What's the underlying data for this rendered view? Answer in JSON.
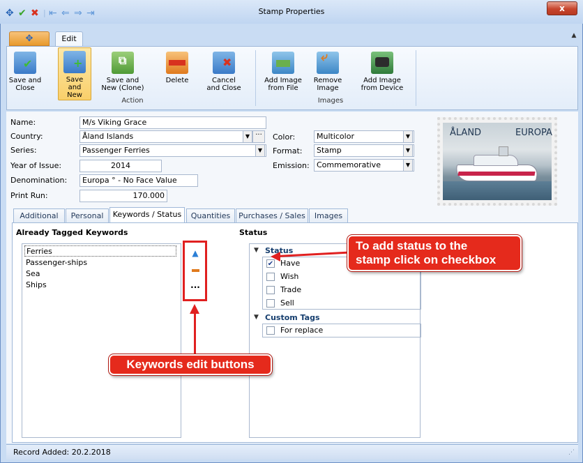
{
  "window": {
    "title": "Stamp Properties",
    "close_glyph": "x"
  },
  "ribbon": {
    "tab_edit": "Edit",
    "buttons": [
      {
        "label": "Save and\nClose",
        "icon": "save-close-icon"
      },
      {
        "label": "Save and\nNew",
        "icon": "save-new-icon"
      },
      {
        "label": "Save and\nNew (Clone)",
        "icon": "save-clone-icon"
      },
      {
        "label": "Delete",
        "icon": "delete-icon"
      },
      {
        "label": "Cancel\nand Close",
        "icon": "cancel-close-icon"
      },
      {
        "label": "Add Image\nfrom File",
        "icon": "add-image-file-icon"
      },
      {
        "label": "Remove\nImage",
        "icon": "remove-image-icon"
      },
      {
        "label": "Add Image\nfrom Device",
        "icon": "add-image-device-icon"
      }
    ],
    "groups": {
      "action": "Action",
      "images": "Images"
    }
  },
  "form": {
    "name_label": "Name:",
    "name_value": "M/s Viking Grace",
    "country_label": "Country:",
    "country_value": "Åland Islands",
    "series_label": "Series:",
    "series_value": "Passenger Ferries",
    "year_label": "Year of Issue:",
    "year_value": "2014",
    "denomination_label": "Denomination:",
    "denomination_value": "Europa ° - No Face Value",
    "print_run_label": "Print Run:",
    "print_run_value": "170.000",
    "color_label": "Color:",
    "color_value": "Multicolor",
    "format_label": "Format:",
    "format_value": "Stamp",
    "emission_label": "Emission:",
    "emission_value": "Commemorative"
  },
  "stamp": {
    "country_text": "ÅLAND",
    "europa_text": "EUROPA"
  },
  "tabs": [
    "Additional",
    "Personal",
    "Keywords / Status",
    "Quantities",
    "Purchases / Sales",
    "Images"
  ],
  "keywords": {
    "header": "Already Tagged Keywords",
    "items": [
      "Ferries",
      "Passenger-ships",
      "Sea",
      "Ships"
    ]
  },
  "status": {
    "header": "Status",
    "group1": "Status",
    "items": [
      {
        "label": "Have",
        "checked": true
      },
      {
        "label": "Wish",
        "checked": false
      },
      {
        "label": "Trade",
        "checked": false
      },
      {
        "label": "Sell",
        "checked": false
      }
    ],
    "group2": "Custom Tags",
    "custom_items": [
      {
        "label": "For replace",
        "checked": false
      }
    ]
  },
  "annotations": {
    "status_callout": "To add status to the\nstamp click on checkbox",
    "keywords_callout": "Keywords edit buttons"
  },
  "statusbar": {
    "text": "Record Added: 20.2.2018"
  },
  "colors": {
    "callout_red": "#e52a1c",
    "ribbon_active": "#f9cf6a",
    "frame_blue": "#c9dcf3"
  }
}
